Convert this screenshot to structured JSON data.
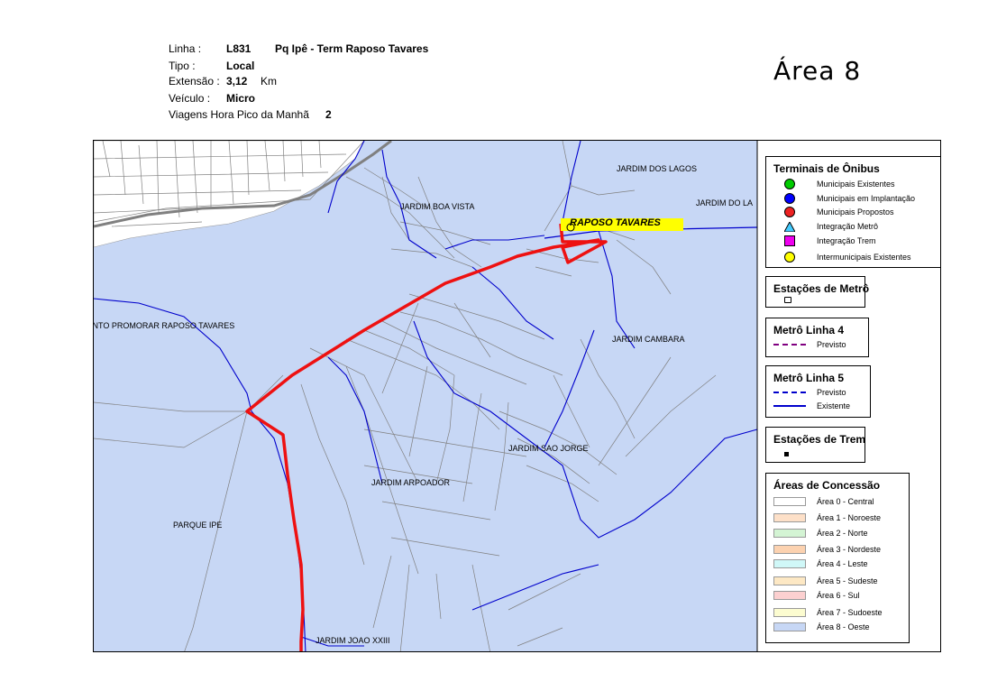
{
  "header": {
    "line_label": "Linha :",
    "line_code": "L831",
    "line_name": "Pq Ipê - Term Raposo Tavares",
    "type_label": "Tipo :",
    "type_value": "Local",
    "length_label": "Extensão :",
    "length_value": "3,12",
    "length_unit": "Km",
    "vehicle_label": "Veículo :",
    "vehicle_value": "Micro",
    "trips_label": "Viagens Hora Pico da Manhã",
    "trips_value": "2"
  },
  "area_title": "Área  8",
  "map": {
    "terminal_label": "RAPOSO TAVARES",
    "place_labels": [
      "JARDIM DOS LAGOS",
      "JARDIM DO LA",
      "JARDIM BOA VISTA",
      "INTO PROMORAR RAPOSO TAVARES",
      "JARDIM CAMBARA",
      "JARDIM SAO JORGE",
      "JARDIM ARPOADOR",
      "PARQUE IPE",
      "JARDIM JOAO XXIII"
    ],
    "colors": {
      "area8": "#c7d7f5",
      "outside": "#ffffff",
      "streets": "#808080",
      "route": "#ee1111",
      "metro5": "#0000cc",
      "rail": "#808080",
      "terminal_highlight": "#ffff00"
    }
  },
  "legend": {
    "terminals": {
      "title": "Terminais de Ônibus",
      "items": [
        {
          "label": "Municipais Existentes",
          "icon": "green-circle-icon",
          "color": "#00cc00"
        },
        {
          "label": "Municipais em Implantação",
          "icon": "blue-circle-icon",
          "color": "#0000ff"
        },
        {
          "label": "Municipais Propostos",
          "icon": "red-circle-icon",
          "color": "#ee2222"
        },
        {
          "label": "Integração Metrô",
          "icon": "cyan-triangle-icon",
          "color": "#44ccff"
        },
        {
          "label": "Integração Trem",
          "icon": "magenta-square-icon",
          "color": "#ee00ee"
        },
        {
          "label": "Intermunicipais Existentes",
          "icon": "yellow-circle-icon",
          "color": "#ffff00"
        }
      ]
    },
    "metro_stations": {
      "title": "Estações de Metrô"
    },
    "metro4": {
      "title": "Metrô Linha 4",
      "items": [
        {
          "label": "Previsto",
          "color": "#800080"
        }
      ]
    },
    "metro5": {
      "title": "Metrô Linha 5",
      "items": [
        {
          "label": "Previsto",
          "color": "#0000cc"
        },
        {
          "label": "Existente",
          "color": "#0000cc"
        }
      ]
    },
    "rail_stations": {
      "title": "Estações de Trem"
    },
    "concession": {
      "title": "Áreas de Concessão",
      "items": [
        {
          "label": "Área 0 - Central",
          "color": "#ffffff"
        },
        {
          "label": "Área 1 - Noroeste",
          "color": "#fde0c8"
        },
        {
          "label": "Área 2 - Norte",
          "color": "#d4f4d4"
        },
        {
          "label": "Área 3 - Nordeste",
          "color": "#fcd2b0"
        },
        {
          "label": "Área 4 - Leste",
          "color": "#d0f8f8"
        },
        {
          "label": "Área 5 - Sudeste",
          "color": "#fde8c4"
        },
        {
          "label": "Área 6 - Sul",
          "color": "#fcd0d0"
        },
        {
          "label": "Área 7 - Sudoeste",
          "color": "#fcfcd0"
        },
        {
          "label": "Área 8 - Oeste",
          "color": "#c7d7f5"
        }
      ]
    }
  }
}
